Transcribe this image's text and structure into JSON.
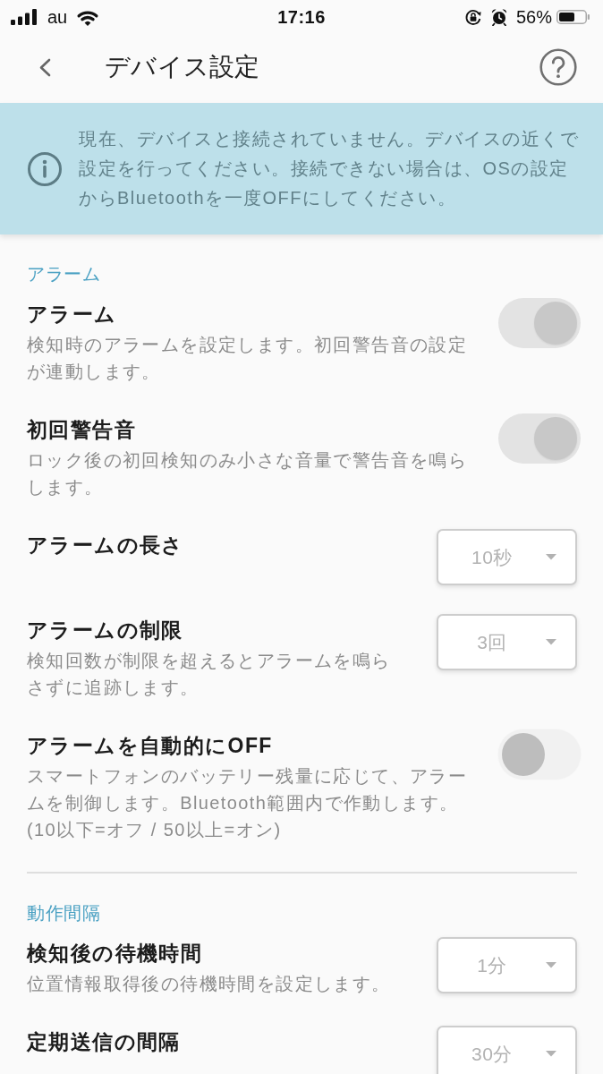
{
  "status_bar": {
    "carrier": "au",
    "time": "17:16",
    "battery": "56%"
  },
  "header": {
    "title": "デバイス設定"
  },
  "notice": {
    "text": "現在、デバイスと接続されていません。デバイスの近くで設定を行ってください。接続できない場合は、OSの設定からBluetoothを一度OFFにしてください。"
  },
  "sections": [
    {
      "title": "アラーム",
      "items": [
        {
          "kind": "toggle",
          "title": "アラーム",
          "description": "検知時のアラームを設定します。初回警告音の設定が連動します。",
          "on": true,
          "disabled": true
        },
        {
          "kind": "toggle",
          "title": "初回警告音",
          "description": "ロック後の初回検知のみ小さな音量で警告音を鳴らします。",
          "on": true,
          "disabled": true
        },
        {
          "kind": "select",
          "title": "アラームの長さ",
          "value": "10秒",
          "disabled": true
        },
        {
          "kind": "select",
          "title": "アラームの制限",
          "description": "検知回数が制限を超えるとアラームを鳴らさずに追跡します。",
          "value": "3回",
          "disabled": true
        },
        {
          "kind": "toggle",
          "title": "アラームを自動的にOFF",
          "description": "スマートフォンのバッテリー残量に応じて、アラームを制御します。Bluetooth範囲内で作動します。\n(10以下=オフ / 50以上=オン)",
          "on": false,
          "disabled": true
        }
      ]
    },
    {
      "title": "動作間隔",
      "items": [
        {
          "kind": "select",
          "title": "検知後の待機時間",
          "description": "位置情報取得後の待機時間を設定します。",
          "value": "1分",
          "disabled": true
        },
        {
          "kind": "select",
          "title": "定期送信の間隔",
          "value": "30分",
          "disabled": true
        }
      ]
    }
  ]
}
